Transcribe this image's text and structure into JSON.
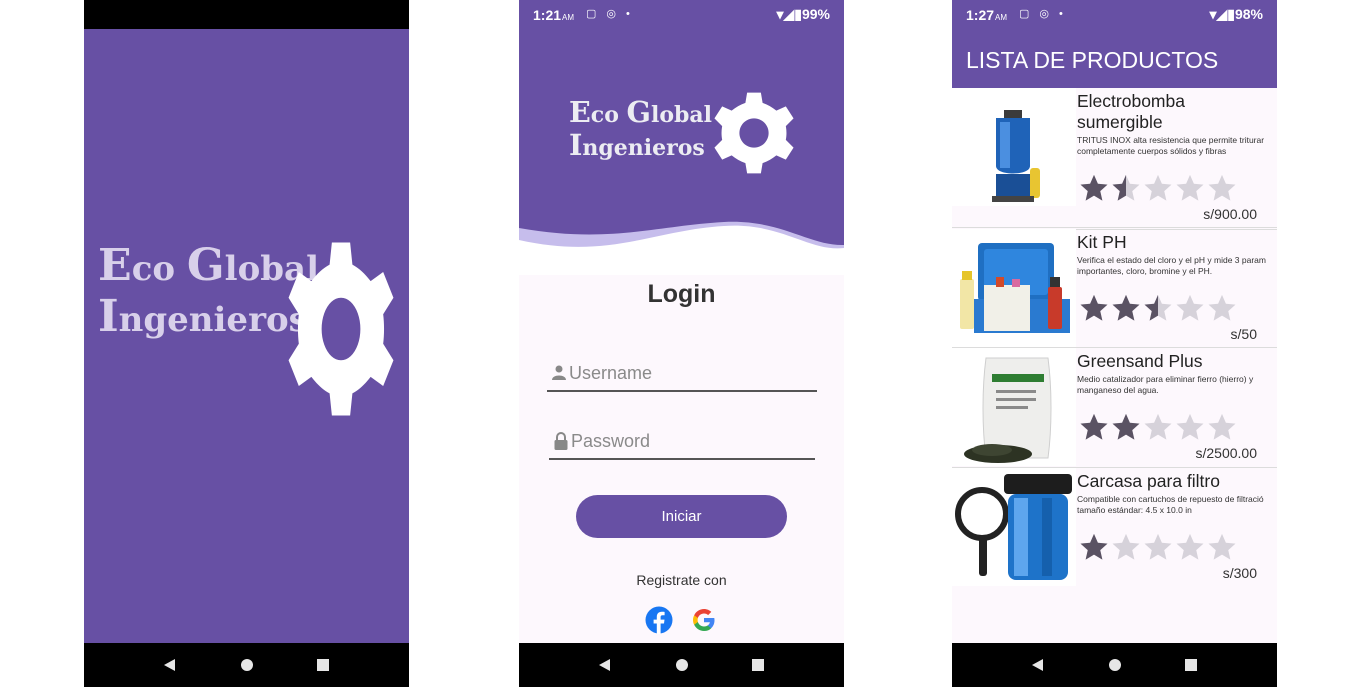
{
  "splash": {
    "brand_line1": "Eco Global",
    "brand_line2": "Ingenieros"
  },
  "login_screen": {
    "status": {
      "time": "1:21",
      "ampm": "AM",
      "battery": "99%"
    },
    "brand_line1": "Eco Global",
    "brand_line2": "Ingenieros",
    "title": "Login",
    "username_placeholder": "Username",
    "password_placeholder": "Password",
    "submit_label": "Iniciar",
    "register_label": "Registrate con",
    "social": [
      "facebook-icon",
      "google-icon"
    ]
  },
  "products_screen": {
    "status": {
      "time": "1:27",
      "ampm": "AM",
      "battery": "98%"
    },
    "title": "LISTA DE PRODUCTOS",
    "products": [
      {
        "name": "Electrobomba\nsumergible",
        "description": "TRITUS INOX alta resistencia que permite triturar\ncompletamente cuerpos sólidos y fibras",
        "rating": 1.5,
        "price": "s/900.00"
      },
      {
        "name": "Kit PH",
        "description": "Verifica el estado del cloro y el pH y mide 3 param\nimportantes, cloro, bromine y el PH.",
        "rating": 2.5,
        "price": "s/50"
      },
      {
        "name": "Greensand Plus",
        "description": "Medio catalizador para eliminar fierro (hierro) y\nmanganeso del agua.",
        "rating": 2,
        "price": "s/2500.00"
      },
      {
        "name": "Carcasa para filtro",
        "description": "Compatible con cartuchos de repuesto de filtració\ntamaño estándar: 4.5 x 10.0 in",
        "rating": 1,
        "price": "s/300"
      }
    ]
  },
  "colors": {
    "primary": "#6750a4",
    "star_filled": "#5a5263",
    "star_empty": "#d6d2da",
    "background": "#fdf8fd"
  }
}
